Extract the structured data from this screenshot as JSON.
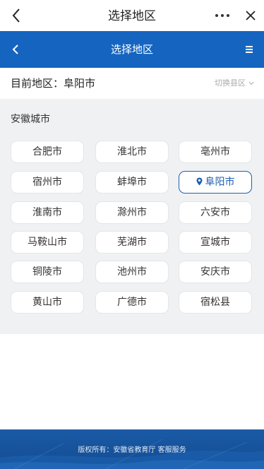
{
  "topbar": {
    "title": "选择地区"
  },
  "header": {
    "title": "选择地区"
  },
  "current": {
    "label": "目前地区：阜阳市",
    "switch_label": "切换县区"
  },
  "province": {
    "title": "安徽城市",
    "cities": [
      {
        "name": "合肥市",
        "selected": false
      },
      {
        "name": "淮北市",
        "selected": false
      },
      {
        "name": "亳州市",
        "selected": false
      },
      {
        "name": "宿州市",
        "selected": false
      },
      {
        "name": "蚌埠市",
        "selected": false
      },
      {
        "name": "阜阳市",
        "selected": true
      },
      {
        "name": "淮南市",
        "selected": false
      },
      {
        "name": "滁州市",
        "selected": false
      },
      {
        "name": "六安市",
        "selected": false
      },
      {
        "name": "马鞍山市",
        "selected": false
      },
      {
        "name": "芜湖市",
        "selected": false
      },
      {
        "name": "宣城市",
        "selected": false
      },
      {
        "name": "铜陵市",
        "selected": false
      },
      {
        "name": "池州市",
        "selected": false
      },
      {
        "name": "安庆市",
        "selected": false
      },
      {
        "name": "黄山市",
        "selected": false
      },
      {
        "name": "广德市",
        "selected": false
      },
      {
        "name": "宿松县",
        "selected": false
      }
    ]
  },
  "footer": {
    "text": "版权所有：安徽省教育厅 客服服务"
  },
  "colors": {
    "brand": "#1565c0",
    "selected": "#1e5fb0",
    "panel": "#f0f1f3"
  }
}
